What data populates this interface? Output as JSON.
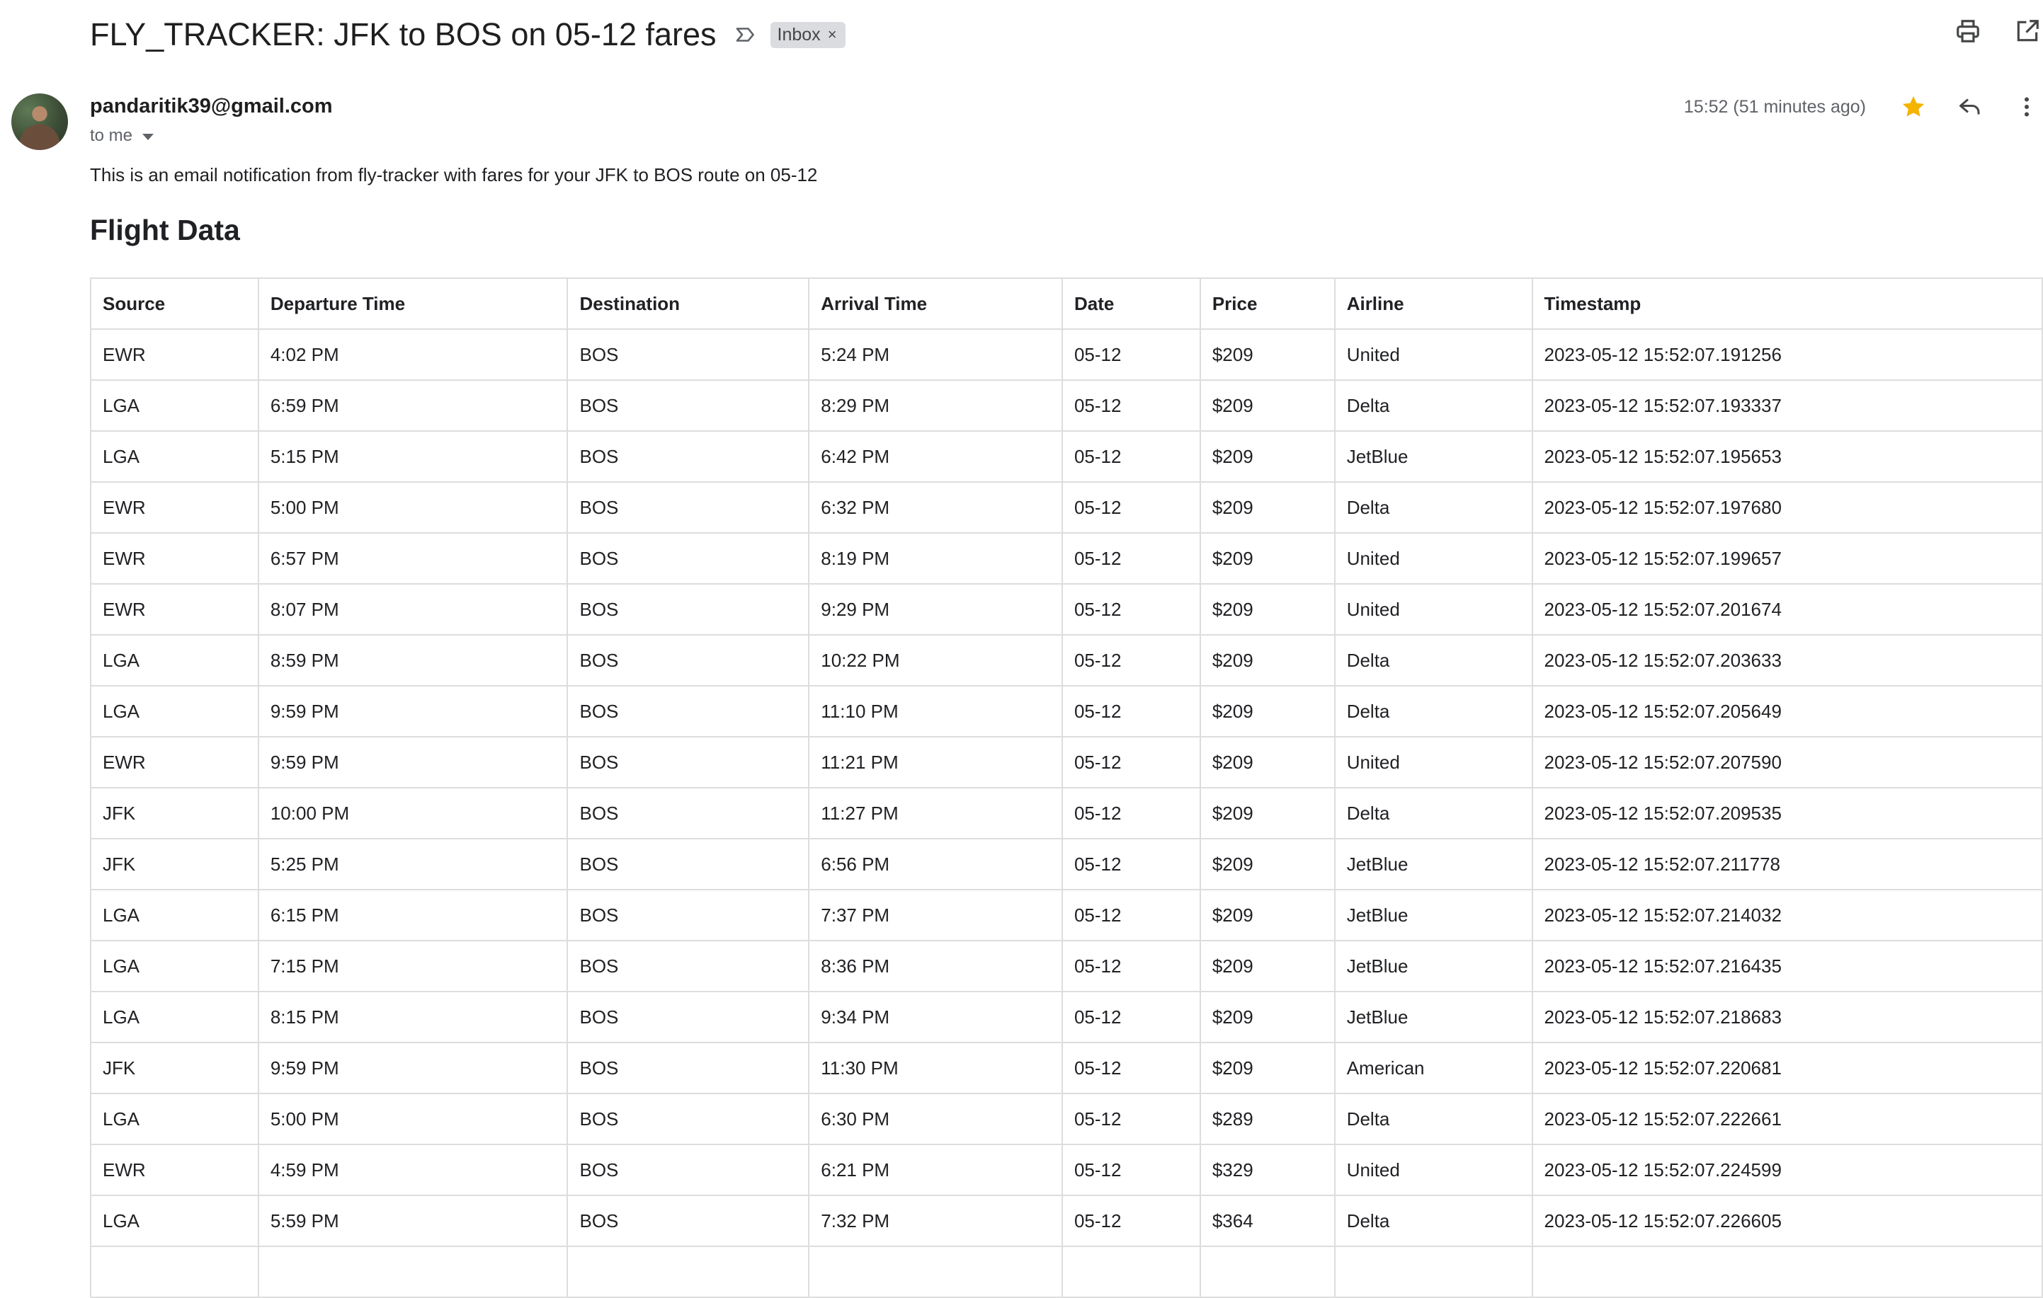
{
  "email": {
    "subject": "FLY_TRACKER: JFK to BOS on 05-12 fares",
    "label": "Inbox",
    "sender": "pandaritik39@gmail.com",
    "recipient_text": "to me",
    "time_text": "15:52 (51 minutes ago)",
    "starred": true,
    "star_color": "#f4b400",
    "intro": "This is an email notification from fly-tracker with fares for your JFK to BOS route on 05-12",
    "heading": "Flight Data"
  },
  "icons": {
    "importance": "label-importance-icon",
    "label_remove": "close-icon",
    "print": "print-icon",
    "open_in_new": "open-in-new-icon",
    "star": "star-icon",
    "reply": "reply-icon",
    "more": "more-vert-icon",
    "recipient_details": "chevron-down-icon"
  },
  "table": {
    "columns": [
      "Source",
      "Departure Time",
      "Destination",
      "Arrival Time",
      "Date",
      "Price",
      "Airline",
      "Timestamp"
    ],
    "rows": [
      [
        "EWR",
        "4:02 PM",
        "BOS",
        "5:24 PM",
        "05-12",
        "$209",
        "United",
        "2023-05-12 15:52:07.191256"
      ],
      [
        "LGA",
        "6:59 PM",
        "BOS",
        "8:29 PM",
        "05-12",
        "$209",
        "Delta",
        "2023-05-12 15:52:07.193337"
      ],
      [
        "LGA",
        "5:15 PM",
        "BOS",
        "6:42 PM",
        "05-12",
        "$209",
        "JetBlue",
        "2023-05-12 15:52:07.195653"
      ],
      [
        "EWR",
        "5:00 PM",
        "BOS",
        "6:32 PM",
        "05-12",
        "$209",
        "Delta",
        "2023-05-12 15:52:07.197680"
      ],
      [
        "EWR",
        "6:57 PM",
        "BOS",
        "8:19 PM",
        "05-12",
        "$209",
        "United",
        "2023-05-12 15:52:07.199657"
      ],
      [
        "EWR",
        "8:07 PM",
        "BOS",
        "9:29 PM",
        "05-12",
        "$209",
        "United",
        "2023-05-12 15:52:07.201674"
      ],
      [
        "LGA",
        "8:59 PM",
        "BOS",
        "10:22 PM",
        "05-12",
        "$209",
        "Delta",
        "2023-05-12 15:52:07.203633"
      ],
      [
        "LGA",
        "9:59 PM",
        "BOS",
        "11:10 PM",
        "05-12",
        "$209",
        "Delta",
        "2023-05-12 15:52:07.205649"
      ],
      [
        "EWR",
        "9:59 PM",
        "BOS",
        "11:21 PM",
        "05-12",
        "$209",
        "United",
        "2023-05-12 15:52:07.207590"
      ],
      [
        "JFK",
        "10:00 PM",
        "BOS",
        "11:27 PM",
        "05-12",
        "$209",
        "Delta",
        "2023-05-12 15:52:07.209535"
      ],
      [
        "JFK",
        "5:25 PM",
        "BOS",
        "6:56 PM",
        "05-12",
        "$209",
        "JetBlue",
        "2023-05-12 15:52:07.211778"
      ],
      [
        "LGA",
        "6:15 PM",
        "BOS",
        "7:37 PM",
        "05-12",
        "$209",
        "JetBlue",
        "2023-05-12 15:52:07.214032"
      ],
      [
        "LGA",
        "7:15 PM",
        "BOS",
        "8:36 PM",
        "05-12",
        "$209",
        "JetBlue",
        "2023-05-12 15:52:07.216435"
      ],
      [
        "LGA",
        "8:15 PM",
        "BOS",
        "9:34 PM",
        "05-12",
        "$209",
        "JetBlue",
        "2023-05-12 15:52:07.218683"
      ],
      [
        "JFK",
        "9:59 PM",
        "BOS",
        "11:30 PM",
        "05-12",
        "$209",
        "American",
        "2023-05-12 15:52:07.220681"
      ],
      [
        "LGA",
        "5:00 PM",
        "BOS",
        "6:30 PM",
        "05-12",
        "$289",
        "Delta",
        "2023-05-12 15:52:07.222661"
      ],
      [
        "EWR",
        "4:59 PM",
        "BOS",
        "6:21 PM",
        "05-12",
        "$329",
        "United",
        "2023-05-12 15:52:07.224599"
      ],
      [
        "LGA",
        "5:59 PM",
        "BOS",
        "7:32 PM",
        "05-12",
        "$364",
        "Delta",
        "2023-05-12 15:52:07.226605"
      ],
      [
        "",
        "",
        "",
        "",
        "",
        "",
        "",
        ""
      ]
    ]
  }
}
